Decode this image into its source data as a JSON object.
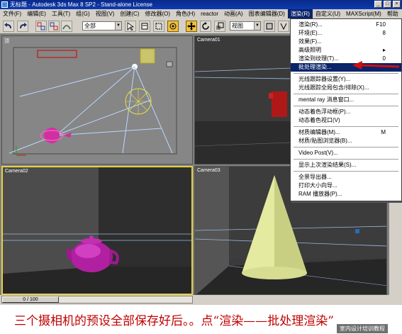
{
  "window": {
    "title": "无标题 - Autodesk 3ds Max 8 SP2  - Stand-alone License",
    "buttons": {
      "minimize": "_",
      "maximize": "□",
      "close": "×"
    }
  },
  "menubar": {
    "items": [
      "文件(F)",
      "编辑(E)",
      "工具(T)",
      "组(G)",
      "视图(V)",
      "创建(C)",
      "修改器(O)",
      "角色(H)",
      "reactor",
      "动画(A)",
      "图表编辑器(D)",
      "渲染(R)",
      "自定义(U)",
      "MAXScript(M)",
      "帮助"
    ],
    "active_index": 11
  },
  "toolbar": {
    "selection_filter": "全部",
    "reference_coord": "视图"
  },
  "viewports": {
    "top_left": {
      "label": "顶"
    },
    "top_right": {
      "label": "Camera01"
    },
    "bottom_left": {
      "label": "Camera02"
    },
    "bottom_right": {
      "label": "Camera03"
    }
  },
  "render_menu": {
    "items": [
      {
        "label": "渲染(R)...",
        "shortcut": "F10"
      },
      {
        "label": "环境(E)...",
        "shortcut": "8"
      },
      {
        "label": "效果(F)...",
        "shortcut": ""
      },
      {
        "label": "高级照明",
        "shortcut": "▸"
      },
      {
        "label": "渲染到纹理(T)...",
        "shortcut": "0"
      },
      {
        "label": "批处理渲染...",
        "shortcut": "",
        "highlighted": true
      },
      {
        "label": "光线跟踪器设置(Y)...",
        "shortcut": ""
      },
      {
        "label": "光线跟踪全局包含/排除(X)...",
        "shortcut": ""
      },
      {
        "label": "mental ray 消息窗口...",
        "shortcut": ""
      },
      {
        "label": "动态着色浮动框(P)...",
        "shortcut": ""
      },
      {
        "label": "动态着色视口(V)",
        "shortcut": ""
      },
      {
        "label": "材质编辑器(M)...",
        "shortcut": "M"
      },
      {
        "label": "材质/贴图浏览器(B)...",
        "shortcut": ""
      },
      {
        "label": "Video Post(V)...",
        "shortcut": ""
      },
      {
        "label": "显示上次渲染结果(S)...",
        "shortcut": ""
      },
      {
        "label": "全景导出器...",
        "shortcut": ""
      },
      {
        "label": "打印大小向导...",
        "shortcut": ""
      },
      {
        "label": "RAM 播放器(P)...",
        "shortcut": ""
      }
    ]
  },
  "timeline": {
    "frame": "0 / 100"
  },
  "caption": {
    "text": "三个摄相机的预设全部保存好后。。点“渲染——批处理渲染”",
    "watermark": "室内设计培训教程"
  },
  "colors": {
    "highlight": "#0a246a",
    "caption": "#c00000",
    "active_viewport_border": "#e8d040"
  }
}
